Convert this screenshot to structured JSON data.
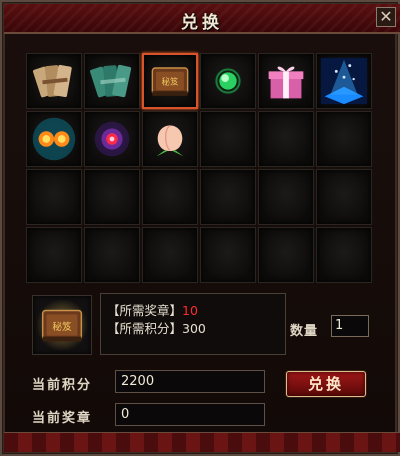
{
  "window": {
    "title": "兑换",
    "close_glyph": "✕"
  },
  "items": [
    {
      "name": "scroll-bundle-icon"
    },
    {
      "name": "jade-scroll-icon"
    },
    {
      "name": "treasure-book-icon",
      "selected": true,
      "label": "秘笈"
    },
    {
      "name": "green-orb-icon"
    },
    {
      "name": "gift-box-icon"
    },
    {
      "name": "blue-light-box-icon"
    },
    {
      "name": "fire-orbs-icon"
    },
    {
      "name": "red-eye-orb-icon"
    },
    {
      "name": "peach-icon"
    },
    {
      "name": "empty"
    },
    {
      "name": "empty"
    },
    {
      "name": "empty"
    },
    {
      "name": "empty"
    },
    {
      "name": "empty"
    },
    {
      "name": "empty"
    },
    {
      "name": "empty"
    },
    {
      "name": "empty"
    },
    {
      "name": "empty"
    },
    {
      "name": "empty"
    },
    {
      "name": "empty"
    },
    {
      "name": "empty"
    },
    {
      "name": "empty"
    },
    {
      "name": "empty"
    },
    {
      "name": "empty"
    }
  ],
  "preview": {
    "icon": "treasure-book-icon",
    "label": "秘笈"
  },
  "requirements": {
    "medal_label": "【所需奖章】",
    "medal_value": "10",
    "points_label": "【所需积分】",
    "points_value": "300"
  },
  "quantity": {
    "label": "数量",
    "value": "1"
  },
  "current": {
    "points_label": "当前积分",
    "points_value": "2200",
    "medal_label": "当前奖章",
    "medal_value": "0"
  },
  "buttons": {
    "exchange_label": "兑换"
  },
  "colors": {
    "accent": "#d9542a",
    "required_medal": "#ff2a2a",
    "title_bar": "#5a0f10"
  }
}
